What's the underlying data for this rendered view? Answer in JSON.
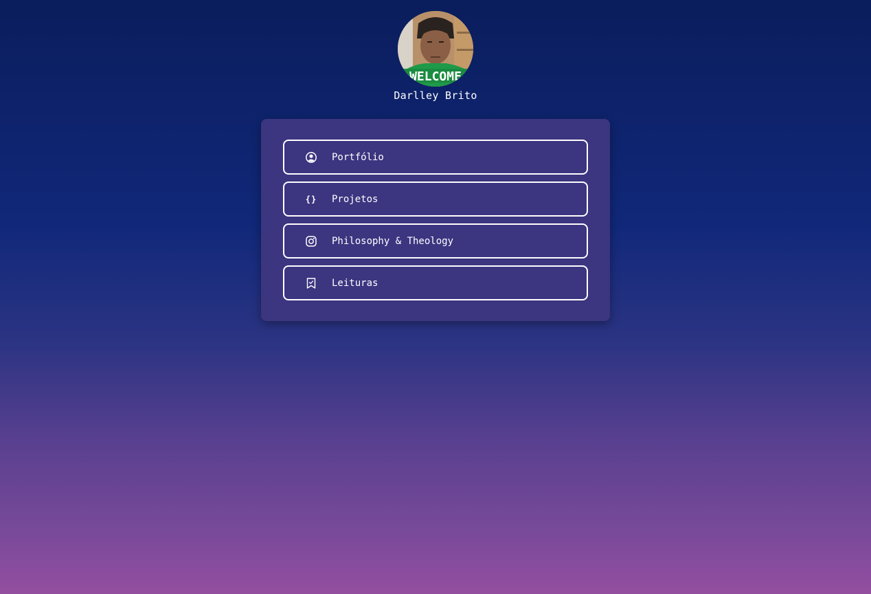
{
  "profile": {
    "name": "Darlley Brito",
    "avatar_shirt_text": "WELCOME"
  },
  "links": [
    {
      "label": "Portfólio",
      "icon": "user-circle-icon"
    },
    {
      "label": "Projetos",
      "icon": "code-braces-icon",
      "glyph": "{}"
    },
    {
      "label": "Philosophy & Theology",
      "icon": "instagram-icon"
    },
    {
      "label": "Leituras",
      "icon": "bookmark-check-icon"
    }
  ],
  "colors": {
    "card": "#3c3580",
    "gradient_top": "#0a1d5c",
    "gradient_bottom": "#944ea0"
  }
}
